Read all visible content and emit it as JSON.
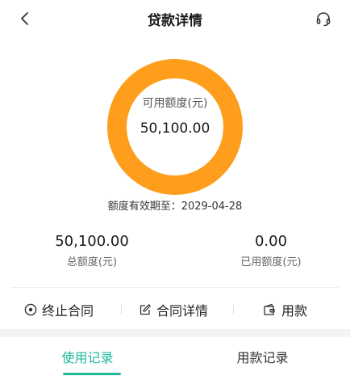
{
  "header": {
    "title": "贷款详情",
    "back_icon": "chevron-left-icon",
    "support_icon": "headset-icon"
  },
  "credit": {
    "available_label": "可用额度(元)",
    "available_value": "50,100.00",
    "validity_text": "额度有效期至：2029-04-28",
    "ring_color": "#FF9D1C",
    "ring_fraction": 1.0
  },
  "stats": {
    "total_value": "50,100.00",
    "total_label": "总额度(元)",
    "used_value": "0.00",
    "used_label": "已用额度(元)"
  },
  "actions": {
    "terminate_label": "终止合同",
    "terminate_icon": "target-icon",
    "detail_label": "合同详情",
    "detail_icon": "edit-document-icon",
    "use_label": "用款",
    "use_icon": "wallet-icon"
  },
  "tabs": {
    "usage_label": "使用记录",
    "draw_label": "用款记录",
    "active_color": "#1FB89B"
  }
}
